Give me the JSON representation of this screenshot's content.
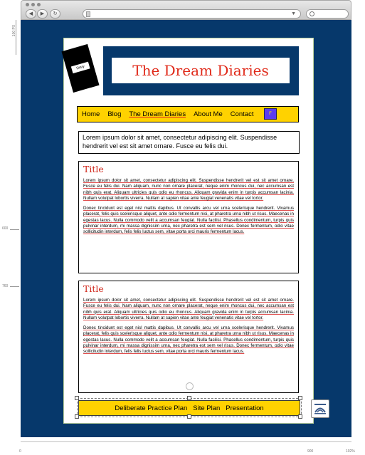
{
  "chrome": {
    "nav_back": "◀",
    "nav_forward": "▶",
    "reload": "↻",
    "url_dropdown": "▼"
  },
  "annotations": {
    "top_ruler_label": "100 PX",
    "side_label_1": "600",
    "side_label_2": "760",
    "bottom_left": "0",
    "bottom_mid": "900",
    "bottom_right": "102%"
  },
  "diary_label": "Diary",
  "site_title": "The Dream Diaries",
  "nav": {
    "items": [
      {
        "label": "Home"
      },
      {
        "label": "Blog"
      },
      {
        "label": "The Dream Diaries"
      },
      {
        "label": "About Me"
      },
      {
        "label": "Contact"
      }
    ],
    "chip_label": "F"
  },
  "intro_text": "Lorem ipsum dolor sit amet, consectetur adipiscing elit. Suspendisse hendrerit vel est sit amet ornare. Fusce eu felis dui.",
  "cards": [
    {
      "title": "Title",
      "paragraphs": [
        "Lorem ipsum dolor sit amet, consectetur adipiscing elit. Suspendisse hendrerit vel est sit amet ornare. Fusce eu felis dui. Nam aliquam, nunc non ornare placerat, neque enim rhoncus dui, nec accumsan est nibh quis erat. Aliquam ultricies quis odio eu rhoncus. Aliquam gravida enim in turpis accumsan lacinia. Nullam volutpat lobortis viverra. Nullam at sapien vitae ante feugiat venenatis vitae vel tortor.",
        "Donec tincidunt est eget nisl mattis dapibus. Ut convallis arcu vel urna scelerisque hendrerit. Vivamus placerat, felis quis scelerisque aliquet, ante odio fermentum nisi, at pharetra urna nibh ut risus. Maecenas in egestas lacus. Nulla commodo velit a accumsan feugiat. Nulla facilisi. Phasellus condimentum, turpis quis pulvinar interdum, mi massa dignissim urna, nec pharetra est sem vel risus. Donec fermentum, odio vitae sollicitudin interdum, felis felis luctus sem, vitae porta orci mauris fermentum lacus."
      ]
    },
    {
      "title": "Title",
      "paragraphs": [
        "Lorem ipsum dolor sit amet, consectetur adipiscing elit. Suspendisse hendrerit vel est sit amet ornare. Fusce eu felis dui. Nam aliquam, nunc non ornare placerat, neque enim rhoncus dui, nec accumsan est nibh quis erat. Aliquam ultricies quis odio eu rhoncus. Aliquam gravida enim in turpis accumsan lacinia. Nullam volutpat lobortis viverra. Nullam at sapien vitae ante feugiat venenatis vitae vel tortor.",
        "Donec tincidunt est eget nisl mattis dapibus. Ut convallis arcu vel urna scelerisque hendrerit. Vivamus placerat, felis quis scelerisque aliquet, ante odio fermentum nisi, at pharetra urna nibh ut risus. Maecenas in egestas lacus. Nulla commodo velit a accumsan feugiat. Nulla facilisi. Phasellus condimentum, turpis quis pulvinar interdum, mi massa dignissim urna, nec pharetra est sem vel risus. Donec fermentum, odio vitae sollicitudin interdum, felis felis luctus sem, vitae porta orci mauris fermentum lacus."
      ]
    }
  ],
  "footer": {
    "links": [
      {
        "label": "Deliberate Practice Plan"
      },
      {
        "label": "Site Plan"
      },
      {
        "label": "Presentation"
      }
    ]
  },
  "colors": {
    "stage_blue": "#06386b",
    "nav_yellow": "#ffd200",
    "title_red": "#e02a1a",
    "chip_purple": "#5a3cf0"
  }
}
